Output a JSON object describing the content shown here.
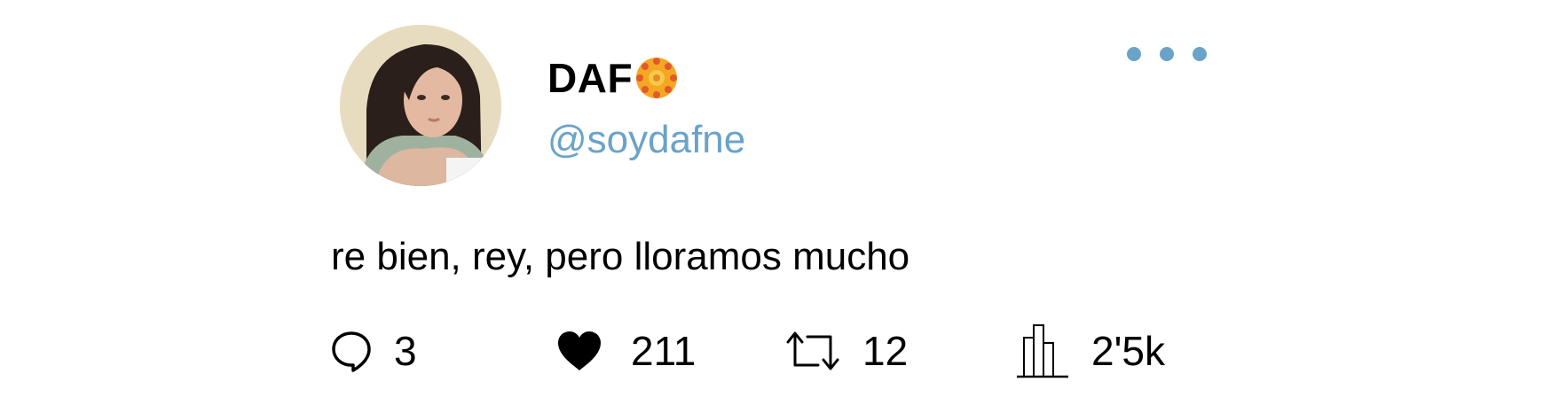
{
  "tweet": {
    "author": {
      "display_name": "DAF",
      "handle": "@soydafne",
      "name_emoji": "flower-emoji-icon",
      "avatar": "profile-photo"
    },
    "text": "re bien, rey, pero lloramos mucho",
    "stats": {
      "replies": "3",
      "likes": "211",
      "retweets": "12",
      "views": "2'5k"
    },
    "icons": {
      "reply": "speech-bubble-icon",
      "like": "heart-icon",
      "retweet": "retweet-arrows-icon",
      "views": "bar-chart-icon",
      "more": "more-dots-icon"
    }
  },
  "colors": {
    "accent": "#6aa3c9",
    "text": "#000000",
    "background": "#ffffff"
  }
}
